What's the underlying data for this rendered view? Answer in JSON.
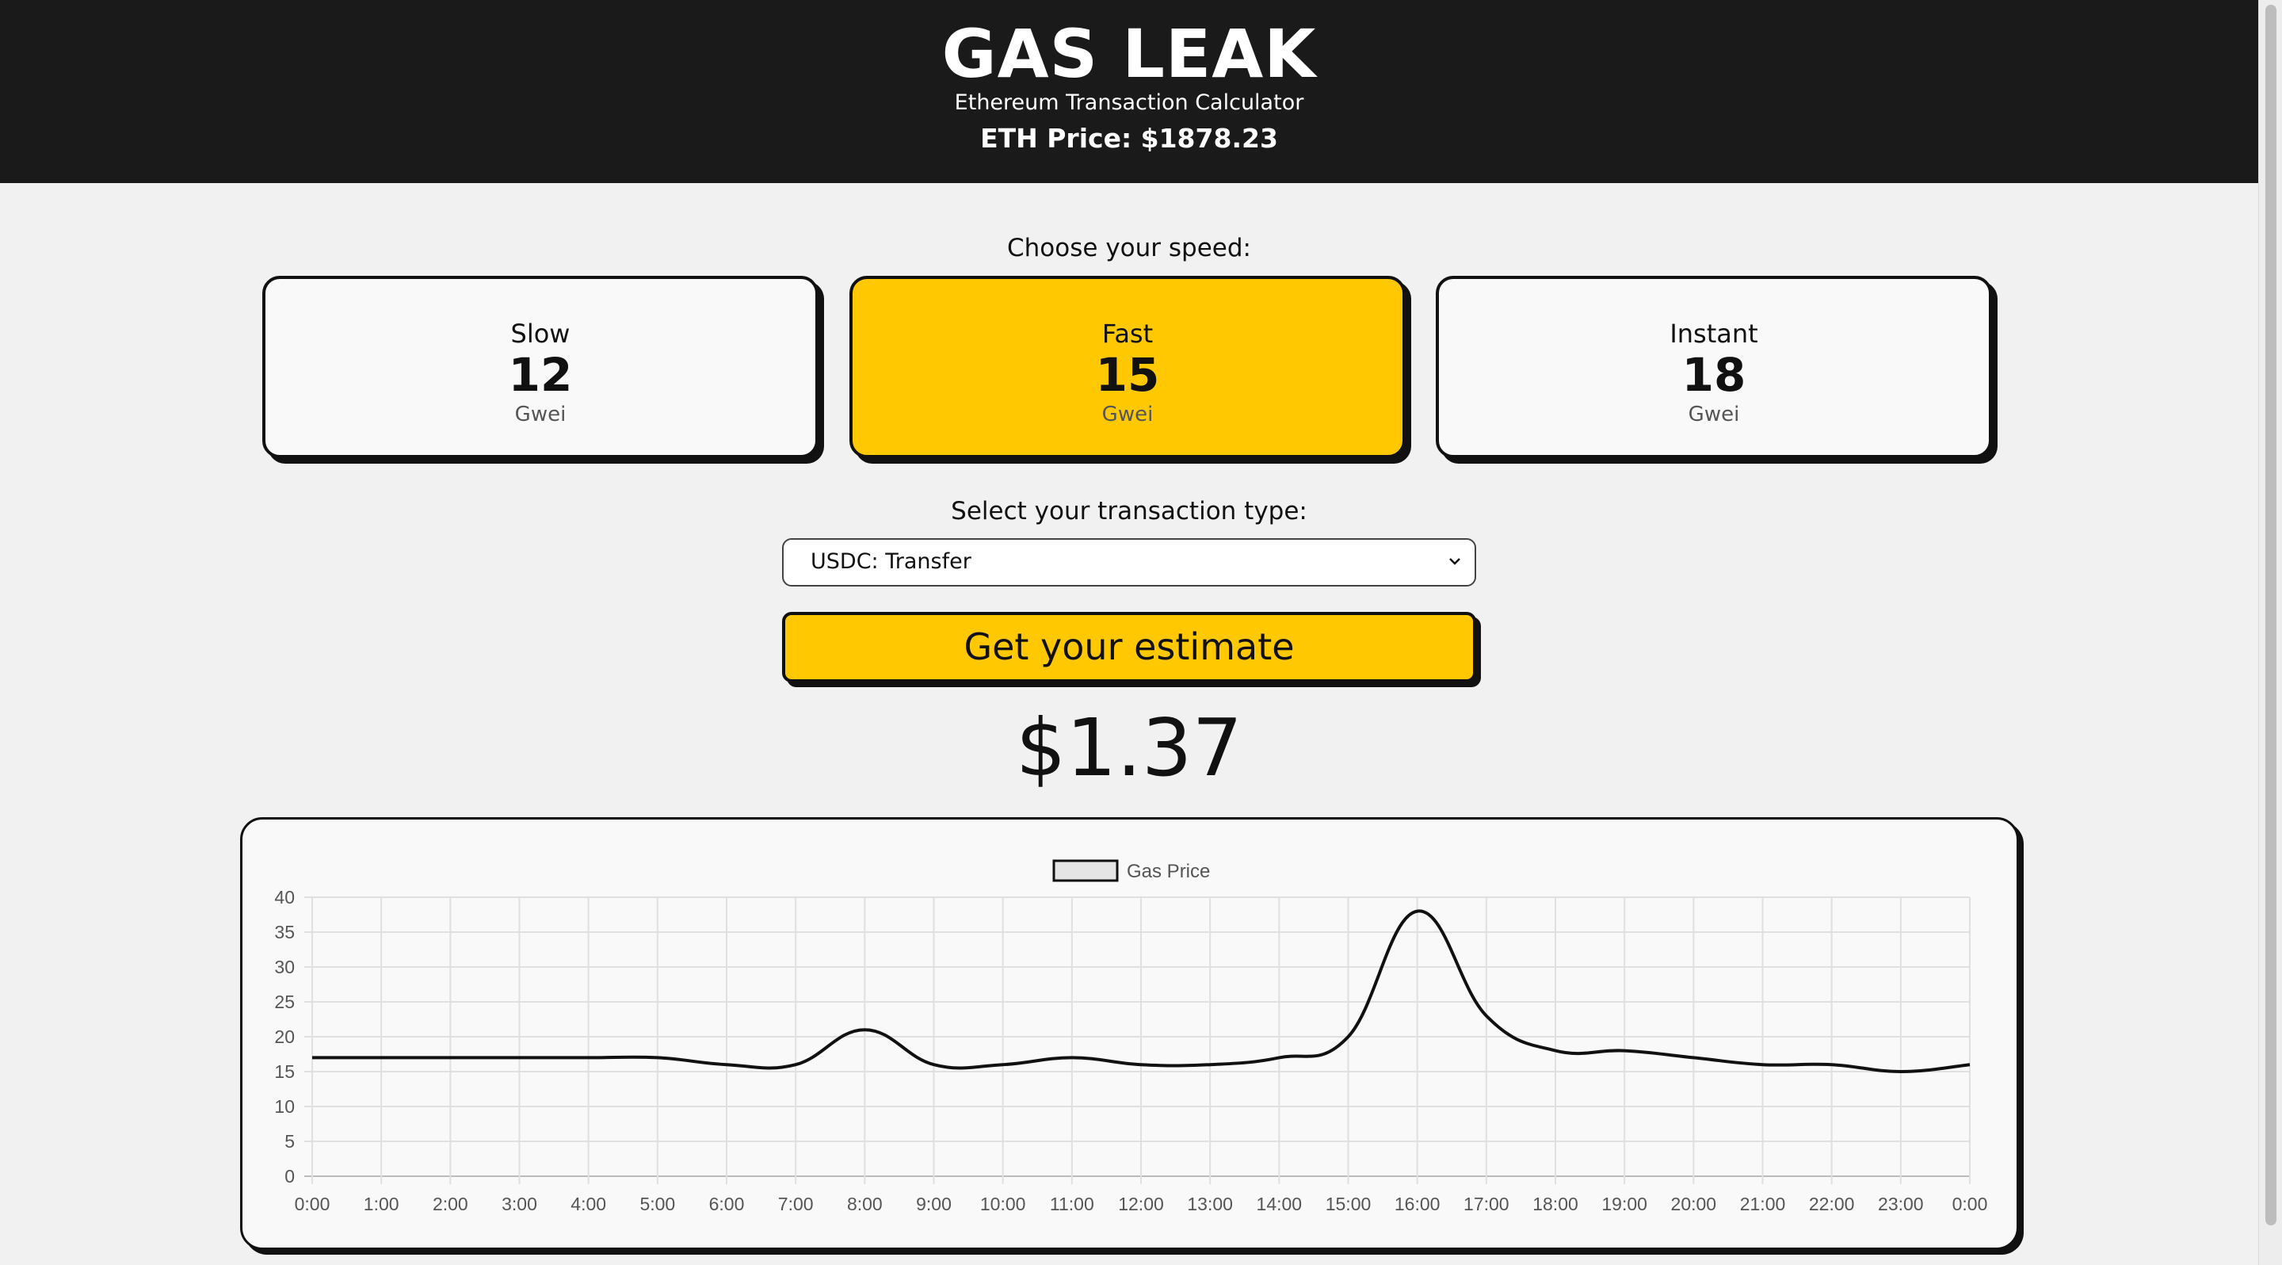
{
  "header": {
    "title": "GAS LEAK",
    "subtitle": "Ethereum Transaction Calculator",
    "eth_price": "ETH Price: $1878.23"
  },
  "speed": {
    "prompt": "Choose your speed:",
    "options": [
      {
        "name": "Slow",
        "value": "12",
        "unit": "Gwei",
        "selected": false
      },
      {
        "name": "Fast",
        "value": "15",
        "unit": "Gwei",
        "selected": true
      },
      {
        "name": "Instant",
        "value": "18",
        "unit": "Gwei",
        "selected": false
      }
    ]
  },
  "transaction": {
    "prompt": "Select your transaction type:",
    "selected": "USDC: Transfer"
  },
  "estimate_button": "Get your estimate",
  "result": "$1.37",
  "colors": {
    "accent": "#ffc800",
    "header_bg": "#1a1a1a",
    "page_bg": "#f1f1f1"
  },
  "chart_data": {
    "type": "line",
    "legend": "Gas Price",
    "x": [
      "0:00",
      "1:00",
      "2:00",
      "3:00",
      "4:00",
      "5:00",
      "6:00",
      "7:00",
      "8:00",
      "9:00",
      "10:00",
      "11:00",
      "12:00",
      "13:00",
      "14:00",
      "15:00",
      "16:00",
      "17:00",
      "18:00",
      "19:00",
      "20:00",
      "21:00",
      "22:00",
      "23:00",
      "0:00"
    ],
    "series": [
      {
        "name": "Gas Price",
        "values": [
          17,
          17,
          17,
          17,
          17,
          17,
          16,
          16,
          21,
          16,
          16,
          17,
          16,
          16,
          17,
          20,
          38,
          23,
          18,
          18,
          17,
          16,
          16,
          15,
          16
        ]
      }
    ],
    "ylim": [
      0,
      40
    ],
    "yticks": [
      0,
      5,
      10,
      15,
      20,
      25,
      30,
      35,
      40
    ],
    "grid": true,
    "legend_position": "top"
  }
}
